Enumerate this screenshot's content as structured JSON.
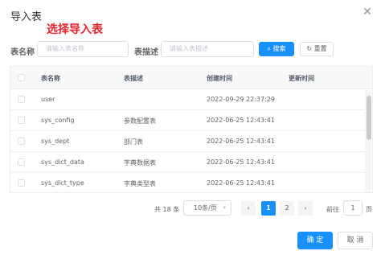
{
  "dialog": {
    "title": "导入表",
    "annotation": "选择导入表",
    "close_icon": "close-icon"
  },
  "search": {
    "table_name_label": "表名称",
    "table_name_placeholder": "请输入表名称",
    "table_desc_label": "表描述",
    "table_desc_placeholder": "请输入表描述",
    "search_button": "搜索",
    "search_icon": "search-icon",
    "reset_button": "重置",
    "reset_icon": "refresh-icon"
  },
  "table": {
    "columns": [
      "表名称",
      "表描述",
      "创建时间",
      "更新时间"
    ],
    "rows": [
      {
        "name": "user",
        "desc": "",
        "created": "2022-09-29 22:37:29",
        "updated": ""
      },
      {
        "name": "sys_config",
        "desc": "参数配置表",
        "created": "2022-06-25 12:43:41",
        "updated": ""
      },
      {
        "name": "sys_dept",
        "desc": "部门表",
        "created": "2022-06-25 12:43:41",
        "updated": ""
      },
      {
        "name": "sys_dict_data",
        "desc": "字典数据表",
        "created": "2022-06-25 12:43:41",
        "updated": ""
      },
      {
        "name": "sys_dict_type",
        "desc": "字典类型表",
        "created": "2022-06-25 12:43:41",
        "updated": ""
      }
    ]
  },
  "pagination": {
    "total_text": "共 18 条",
    "page_size": "10条/页",
    "prev_icon": "chevron-left-icon",
    "next_icon": "chevron-right-icon",
    "pages": [
      "1",
      "2"
    ],
    "current_page": "1",
    "goto_label": "前往",
    "goto_value": "1",
    "goto_suffix": "页"
  },
  "footer": {
    "ok_button": "确 定",
    "cancel_button": "取 消"
  },
  "colors": {
    "primary": "#1890ff",
    "annotation": "#e8232c"
  }
}
